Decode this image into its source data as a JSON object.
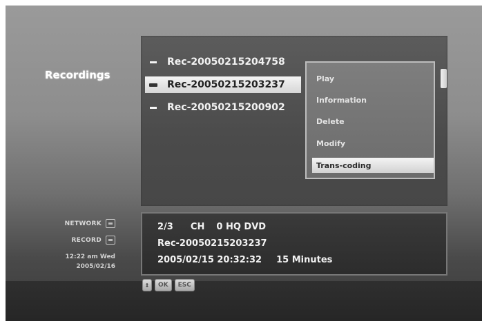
{
  "section_title": "Recordings",
  "recordings": [
    {
      "name": "Rec-20050215204758",
      "selected": false
    },
    {
      "name": "Rec-20050215203237",
      "selected": true
    },
    {
      "name": "Rec-20050215200902",
      "selected": false
    }
  ],
  "context_menu": {
    "items": [
      {
        "label": "Play"
      },
      {
        "label": "Information"
      },
      {
        "label": "Delete"
      },
      {
        "label": "Modify"
      },
      {
        "label": "Trans-coding"
      }
    ],
    "active_index": 4
  },
  "info": {
    "position": "2/3",
    "channel_label": "CH",
    "channel_number": "0",
    "quality": "HQ DVD",
    "name": "Rec-20050215203237",
    "datetime": "2005/02/15 20:32:32",
    "duration": "15 Minutes"
  },
  "status": {
    "network_label": "NETWORK",
    "record_label": "RECORD",
    "time": "12:22 am Wed",
    "date": "2005/02/16"
  },
  "keys": {
    "arrows": "⇕",
    "ok": "OK",
    "esc": "ESC"
  }
}
